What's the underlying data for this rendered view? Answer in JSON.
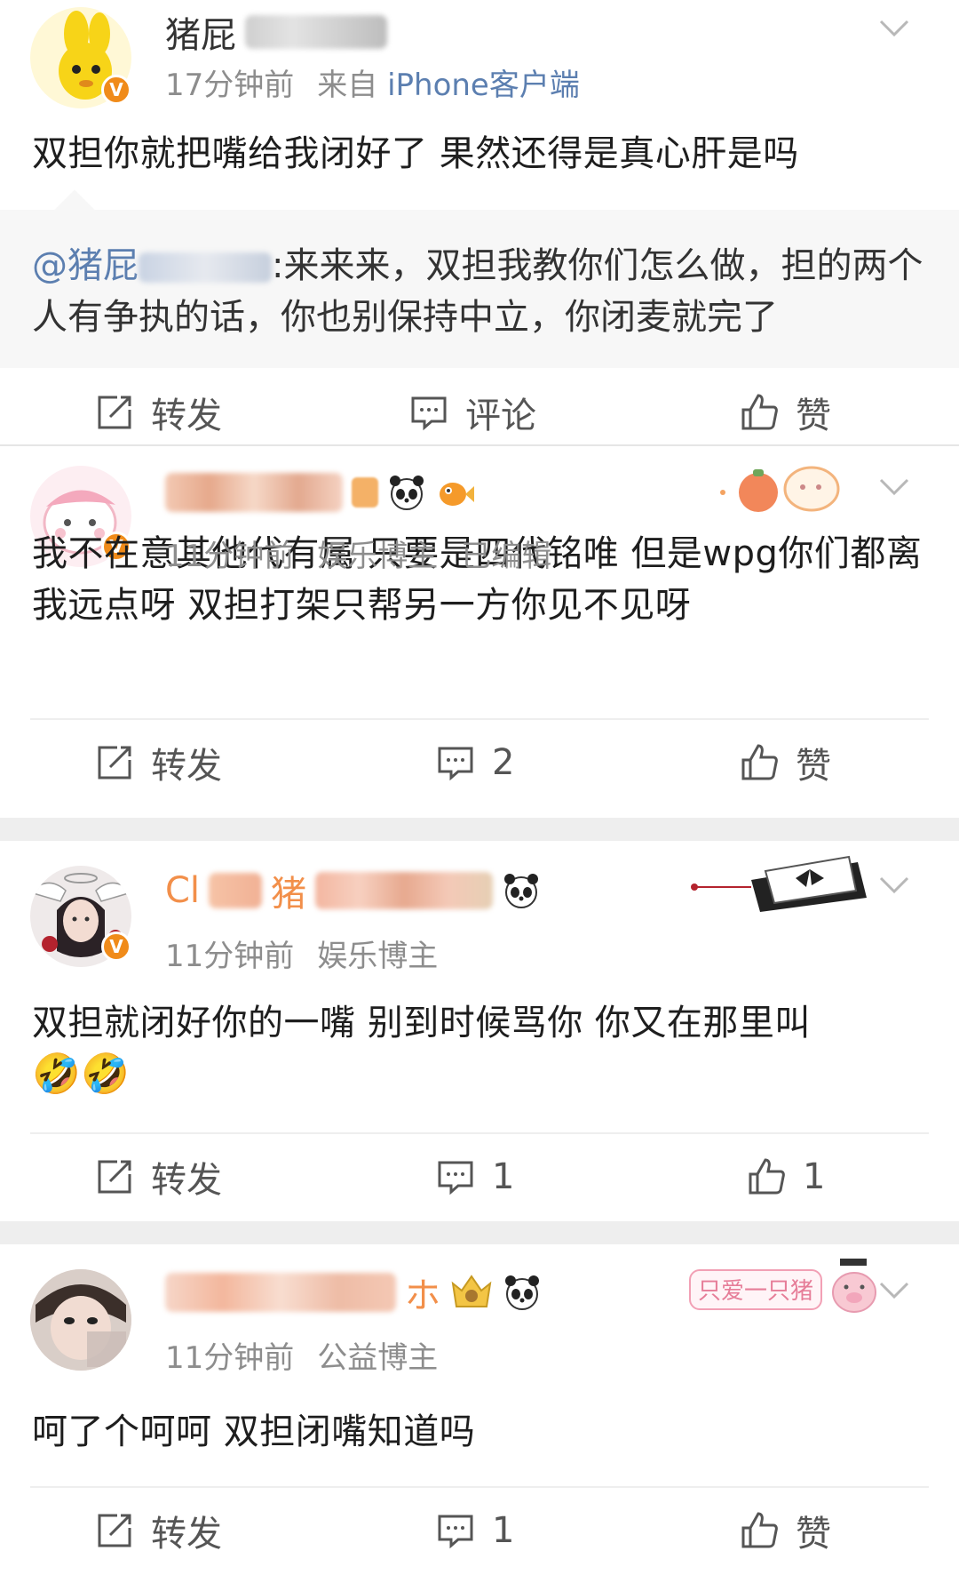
{
  "posts": [
    {
      "name_visible": "猪屁",
      "time": "17分钟前",
      "source_prefix": "来自",
      "source": "iPhone客户端",
      "verified_badge": "V",
      "content": "双担你就把嘴给我闭好了  果然还得是真心肝是吗",
      "quote": {
        "at": "@猪屁",
        "at_tail": "_",
        "text": ":来来来，双担我教你们怎么做，担的两个人有争执的话，你也别保持中立，你闭麦就完了"
      },
      "actions": {
        "repost": "转发",
        "comment": "评论",
        "like": "赞"
      }
    },
    {
      "time": "11分钟前",
      "role": "娱乐博主",
      "edited": "已编辑",
      "verified_badge": "V",
      "content": "我不在意其他代有属 只要是四代铭唯 但是wpg你们都离我远点呀 双担打架只帮另一方你见不见呀",
      "actions": {
        "repost": "转发",
        "comment": "2",
        "like": "赞"
      }
    },
    {
      "name_visible_a": "Cl",
      "name_visible_b": "猪",
      "time": "11分钟前",
      "role": "娱乐博主",
      "verified_badge": "V",
      "content": "双担就闭好你的一嘴 别到时候骂你 你又在那里叫",
      "emoji": "🤣🤣",
      "actions": {
        "repost": "转发",
        "comment": "1",
        "like": "1"
      }
    },
    {
      "name_visible": "ホ",
      "time": "11分钟前",
      "role": "公益博主",
      "decor_text": "只爱一只猪",
      "content": "呵了个呵呵 双担闭嘴知道吗",
      "actions": {
        "repost": "转发",
        "comment": "1",
        "like": "赞"
      }
    }
  ],
  "icons": {
    "chevron": "chevron-down-icon",
    "repost": "repost-icon",
    "comment": "comment-icon",
    "like": "like-icon"
  },
  "colors": {
    "link": "#5c7fb0",
    "meta": "#8d8d8d",
    "badge": "#f08b1a",
    "separator": "#eeeeee"
  }
}
